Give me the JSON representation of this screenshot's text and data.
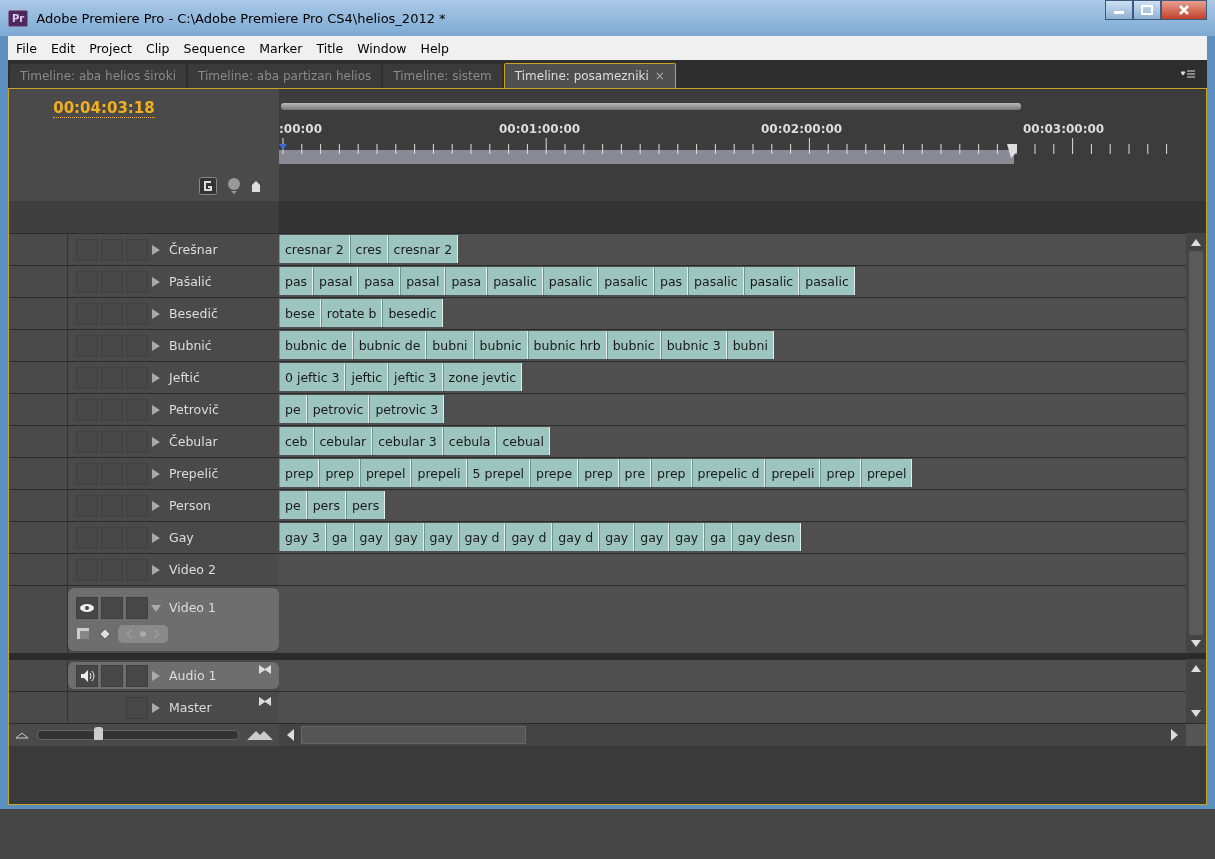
{
  "window": {
    "app_badge": "Pr",
    "title": "Adobe Premiere Pro - C:\\Adobe Premiere Pro CS4\\helios_2012 *"
  },
  "menu": [
    "File",
    "Edit",
    "Project",
    "Clip",
    "Sequence",
    "Marker",
    "Title",
    "Window",
    "Help"
  ],
  "tabs": [
    {
      "label": "Timeline: aba helios široki",
      "selected": false
    },
    {
      "label": "Timeline: aba partizan helios",
      "selected": false
    },
    {
      "label": "Timeline: sistem",
      "selected": false
    },
    {
      "label": "Timeline: posamezniki",
      "selected": true,
      "close": "×"
    }
  ],
  "timecode": "00:04:03:18",
  "ruler": {
    "labels": [
      ":00:00",
      "00:01:00:00",
      "00:02:00:00",
      "00:03:00:00"
    ]
  },
  "tracks": [
    {
      "name": "Črešnar",
      "expanded": false,
      "selected": false,
      "clips": [
        "cresnar 2",
        "cres",
        "cresnar 2"
      ]
    },
    {
      "name": "Pašalić",
      "expanded": false,
      "selected": false,
      "clips": [
        "pas",
        "pasal",
        "pasa",
        "pasal",
        "pasa",
        "pasalic",
        "pasalic",
        "pasalic",
        "pas",
        "pasalic",
        "pasalic",
        "pasalic"
      ]
    },
    {
      "name": "Besedič",
      "expanded": false,
      "selected": false,
      "clips": [
        "bese",
        "rotate b",
        "besedic"
      ]
    },
    {
      "name": "Bubnić",
      "expanded": false,
      "selected": false,
      "clips": [
        "bubnic de",
        "bubnic de",
        "bubni",
        "bubnic",
        "bubnic hrb",
        "bubnic",
        "bubnic 3",
        "bubni"
      ]
    },
    {
      "name": "Jeftić",
      "expanded": false,
      "selected": false,
      "clips": [
        "0 jeftic 3",
        "jeftic",
        "jeftic 3",
        "zone jevtic"
      ]
    },
    {
      "name": "Petrovič",
      "expanded": false,
      "selected": false,
      "clips": [
        "pe",
        "petrovic",
        "petrovic 3"
      ]
    },
    {
      "name": "Čebular",
      "expanded": false,
      "selected": false,
      "clips": [
        "ceb",
        "cebular",
        "cebular 3",
        "cebula",
        "cebual"
      ]
    },
    {
      "name": "Prepelič",
      "expanded": false,
      "selected": false,
      "clips": [
        "prep",
        "prep",
        "prepel",
        "prepeli",
        "5 prepel",
        "prepe",
        "prep",
        "pre",
        "prep",
        "prepelic d",
        "prepeli",
        "prep",
        "prepel"
      ]
    },
    {
      "name": "Person",
      "expanded": false,
      "selected": false,
      "clips": [
        "pe",
        "pers",
        "pers"
      ]
    },
    {
      "name": "Gay",
      "expanded": false,
      "selected": false,
      "clips": [
        "gay 3",
        "ga",
        "gay",
        "gay",
        "gay",
        "gay d",
        "gay d",
        "gay d",
        "gay",
        "gay",
        "gay",
        "ga",
        "gay desn"
      ]
    },
    {
      "name": "Video 2",
      "expanded": false,
      "selected": false
    },
    {
      "name": "Video 1",
      "expanded": true,
      "selected": true
    }
  ],
  "audio_tracks": [
    {
      "name": "Audio 1",
      "kind": "audio",
      "expanded": false,
      "selected": true
    },
    {
      "name": "Master",
      "kind": "master",
      "expanded": false,
      "selected": false
    }
  ],
  "zoom": {
    "level": 0.3
  }
}
